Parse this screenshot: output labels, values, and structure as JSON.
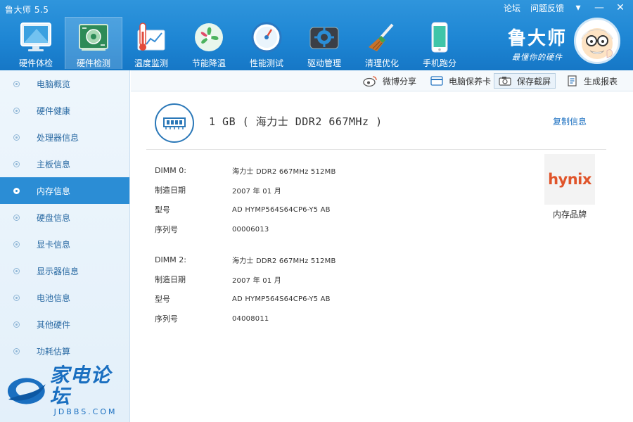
{
  "app": {
    "title": "鲁大师 5.5",
    "links": [
      "论坛",
      "问题反馈"
    ],
    "brand_name": "鲁大师",
    "brand_slogan": "最懂你的硬件"
  },
  "window_controls": {
    "menu": "▾",
    "minimize": "—",
    "close": "✕"
  },
  "toolbar_main": [
    {
      "label": "硬件体检",
      "icon": "monitor-icon"
    },
    {
      "label": "硬件检测",
      "icon": "circuit-board-icon",
      "active": true
    },
    {
      "label": "温度监测",
      "icon": "thermometer-icon"
    },
    {
      "label": "节能降温",
      "icon": "fan-icon"
    },
    {
      "label": "性能测试",
      "icon": "speedometer-icon"
    },
    {
      "label": "驱动管理",
      "icon": "gear-icon"
    },
    {
      "label": "清理优化",
      "icon": "broom-icon"
    },
    {
      "label": "手机跑分",
      "icon": "phone-icon"
    }
  ],
  "sidebar": {
    "items": [
      {
        "label": "电脑概览"
      },
      {
        "label": "硬件健康"
      },
      {
        "label": "处理器信息"
      },
      {
        "label": "主板信息"
      },
      {
        "label": "内存信息",
        "active": true
      },
      {
        "label": "硬盘信息"
      },
      {
        "label": "显卡信息"
      },
      {
        "label": "显示器信息"
      },
      {
        "label": "电池信息"
      },
      {
        "label": "其他硬件"
      },
      {
        "label": "功耗估算"
      }
    ],
    "logo_text": "家电论坛",
    "logo_sub": "JDBBS.COM"
  },
  "actions": {
    "weibo_share": "微博分享",
    "warranty_card": "电脑保养卡",
    "save_screenshot": "保存截屏",
    "generate_report": "生成报表"
  },
  "memory": {
    "summary": "1 GB ( 海力士 DDR2 667MHz )",
    "copy_info": "复制信息",
    "brand_caption": "内存品牌",
    "brand_logo": "hynix",
    "modules": [
      {
        "dimm_label": "DIMM 0:",
        "dimm_value": "海力士 DDR2 667MHz 512MB",
        "date_label": "制造日期",
        "date_value": "2007 年 01 月",
        "model_label": "型号",
        "model_value": "AD HYMP564S64CP6-Y5  AB",
        "serial_label": "序列号",
        "serial_value": "00006013"
      },
      {
        "dimm_label": "DIMM 2:",
        "dimm_value": "海力士 DDR2 667MHz 512MB",
        "date_label": "制造日期",
        "date_value": "2007 年 01 月",
        "model_label": "型号",
        "model_value": "AD HYMP564S64CP6-Y5  AB",
        "serial_label": "序列号",
        "serial_value": "04008011"
      }
    ]
  },
  "colors": {
    "header_blue": "#1e86d4",
    "active_blue": "#2b8dd5",
    "link_blue": "#1a6fc0",
    "hynix_orange": "#e0542a"
  }
}
